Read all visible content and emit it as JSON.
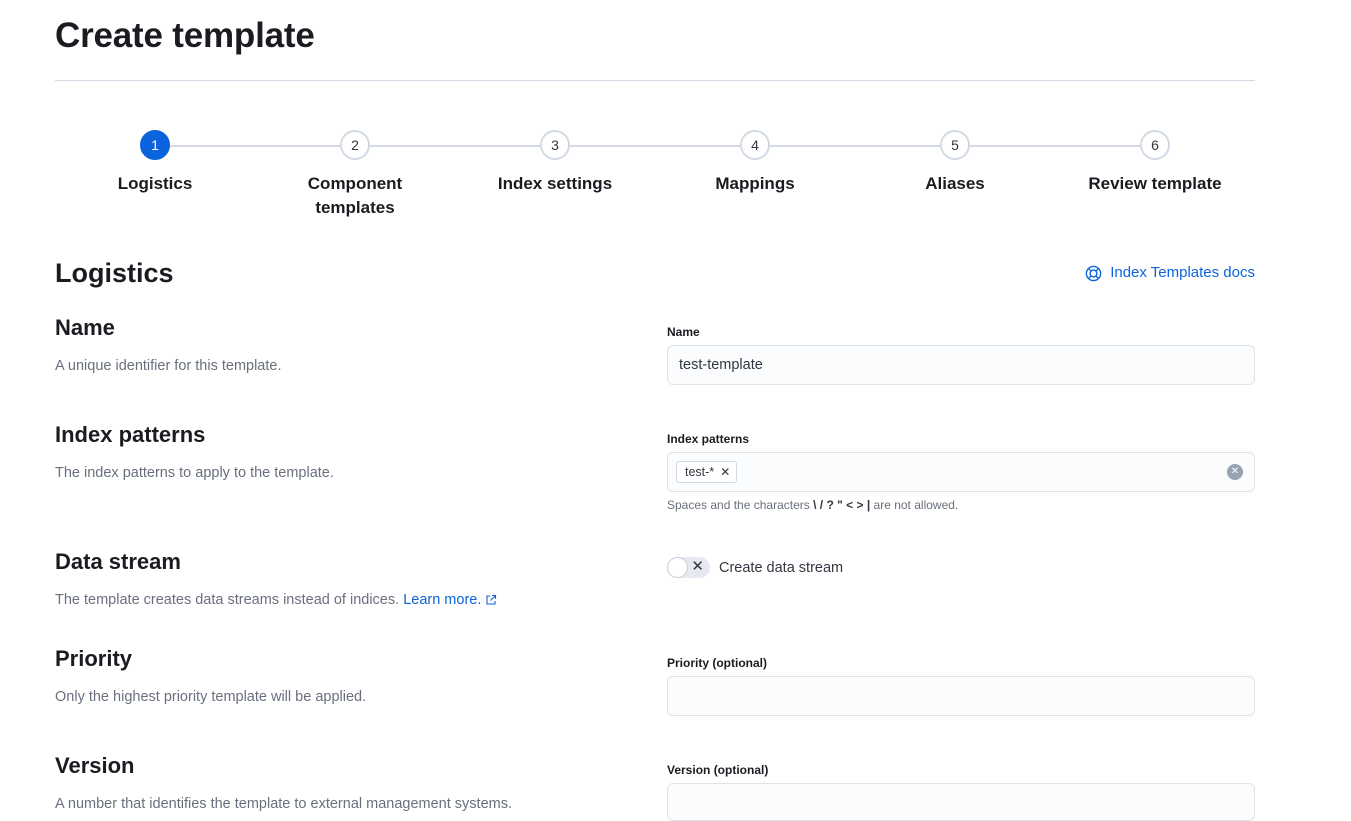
{
  "page": {
    "title": "Create template"
  },
  "steps": [
    {
      "number": "1",
      "title": "Logistics"
    },
    {
      "number": "2",
      "title": "Component templates"
    },
    {
      "number": "3",
      "title": "Index settings"
    },
    {
      "number": "4",
      "title": "Mappings"
    },
    {
      "number": "5",
      "title": "Aliases"
    },
    {
      "number": "6",
      "title": "Review template"
    }
  ],
  "logistics": {
    "title": "Logistics",
    "docs_link": "Index Templates docs",
    "name": {
      "title": "Name",
      "description": "A unique identifier for this template.",
      "label": "Name",
      "value": "test-template"
    },
    "index_patterns": {
      "title": "Index patterns",
      "description": "The index patterns to apply to the template.",
      "label": "Index patterns",
      "pills": [
        "test-*"
      ],
      "help_prefix": "Spaces and the characters",
      "help_chars": "\\ / ? \" < > |",
      "help_suffix": "are not allowed."
    },
    "data_stream": {
      "title": "Data stream",
      "description": "The template creates data streams instead of indices.",
      "learn_more": "Learn more.",
      "toggle_label": "Create data stream"
    },
    "priority": {
      "title": "Priority",
      "description": "Only the highest priority template will be applied.",
      "label": "Priority (optional)",
      "value": ""
    },
    "version": {
      "title": "Version",
      "description": "A number that identifies the template to external management systems.",
      "label": "Version (optional)",
      "value": ""
    }
  },
  "colors": {
    "accent": "#0b64dd",
    "text": "#1a1c21",
    "muted": "#69707d",
    "border": "#d3dae6"
  }
}
